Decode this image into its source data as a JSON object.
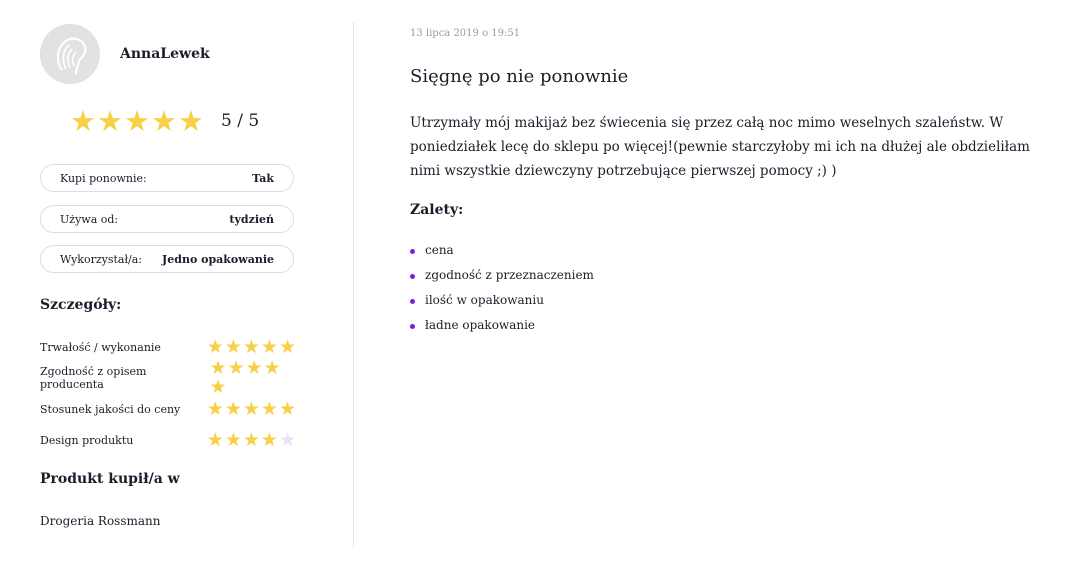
{
  "review": {
    "author": "AnnaLewek",
    "date": "13 lipca 2019 o 19:51",
    "title": "Sięgnę po nie ponownie",
    "rating_stars": 5,
    "rating_text": "5 / 5",
    "body": "Utrzymały mój makijaż bez świecenia się przez całą noc mimo weselnych szaleństw. W poniedziałek lecę do sklepu po więcej!(pewnie starczyłoby mi ich na dłużej ale obdzieliłam nimi wszystkie dziewczyny potrzebujące pierwszej pomocy ;) )"
  },
  "attributes": [
    {
      "label": "Kupi ponownie:",
      "value": "Tak"
    },
    {
      "label": "Używa od:",
      "value": "tydzień"
    },
    {
      "label": "Wykorzystał/a:",
      "value": "Jedno opakowanie"
    }
  ],
  "details": {
    "title": "Szczegóły:",
    "items": [
      {
        "label": "Trwałość / wykonanie",
        "stars": 5
      },
      {
        "label": "Zgodność z opisem producenta",
        "stars": 5
      },
      {
        "label": "Stosunek jakości do ceny",
        "stars": 5
      },
      {
        "label": "Design produktu",
        "stars": 4
      }
    ],
    "max_stars": 5
  },
  "purchase": {
    "title": "Produkt kupił/a w",
    "shop": "Drogeria Rossmann"
  },
  "pros": {
    "title": "Zalety:",
    "items": [
      "cena",
      "zgodność z przeznaczeniem",
      "ilość w opakowaniu",
      "ładne opakowanie"
    ]
  },
  "colors": {
    "star_filled": "#f7d047",
    "star_empty": "#e9e1f5",
    "bullet": "#7a1fd6",
    "divider": "#e4e4ee"
  },
  "icons": {
    "avatar": "avatar-placeholder-icon",
    "star": "star-icon"
  }
}
